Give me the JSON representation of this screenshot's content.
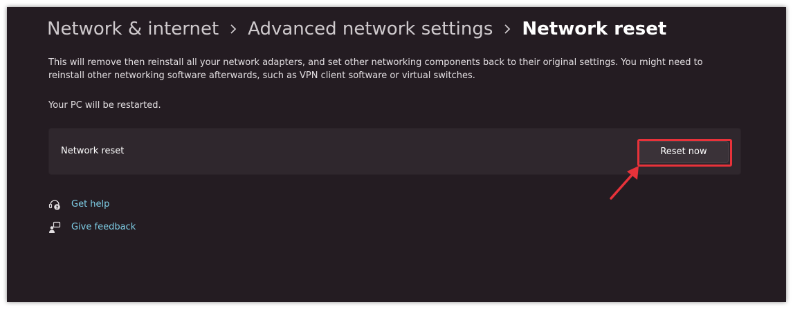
{
  "breadcrumb": {
    "item1": "Network & internet",
    "item2": "Advanced network settings",
    "current": "Network reset"
  },
  "description": "This will remove then reinstall all your network adapters, and set other networking components back to their original settings. You might need to reinstall other networking software afterwards, such as VPN client software or virtual switches.",
  "restart_note": "Your PC will be restarted.",
  "card": {
    "label": "Network reset",
    "button_label": "Reset now"
  },
  "links": {
    "get_help": "Get help",
    "give_feedback": "Give feedback"
  },
  "colors": {
    "background": "#241c22",
    "card": "#2f272d",
    "link": "#7fcfe8",
    "annotation": "#e8323a"
  },
  "icons": {
    "breadcrumb_separator": "chevron-right-icon",
    "help": "get-help-icon",
    "feedback": "feedback-icon"
  }
}
